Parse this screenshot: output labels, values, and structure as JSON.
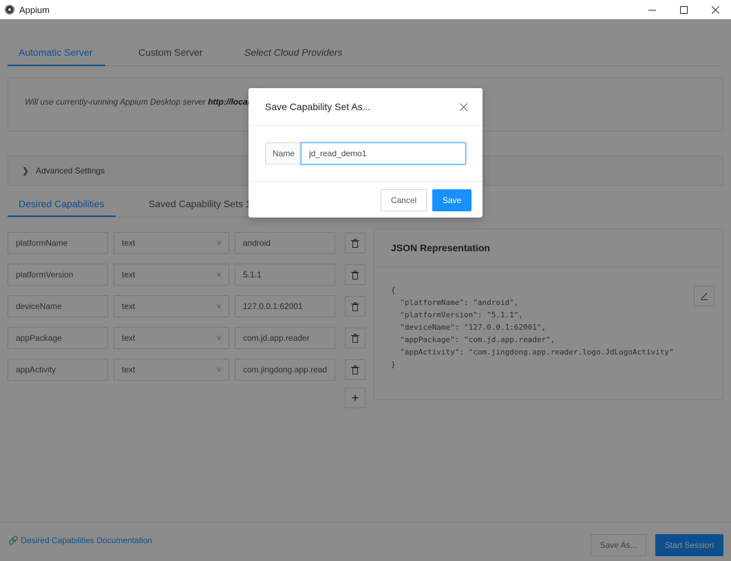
{
  "window": {
    "title": "Appium"
  },
  "server_tabs": [
    {
      "label": "Automatic Server"
    },
    {
      "label": "Custom Server"
    },
    {
      "label": "Select Cloud Providers"
    }
  ],
  "server_info": {
    "text": "Will use currently-running Appium Desktop server ",
    "url": "http://local"
  },
  "advanced": {
    "label": "Advanced Settings"
  },
  "caps_tabs": [
    {
      "label": "Desired Capabilities"
    },
    {
      "label": "Saved Capability Sets 1"
    }
  ],
  "capabilities": [
    {
      "name": "platformName",
      "type": "text",
      "value": "android"
    },
    {
      "name": "platformVersion",
      "type": "text",
      "value": "5.1.1"
    },
    {
      "name": "deviceName",
      "type": "text",
      "value": "127.0.0.1:62001"
    },
    {
      "name": "appPackage",
      "type": "text",
      "value": "com.jd.app.reader"
    },
    {
      "name": "appActivity",
      "type": "text",
      "value": "com.jingdong.app.read"
    }
  ],
  "json_panel": {
    "title": "JSON Representation",
    "content": "{\n  \"platformName\": \"android\",\n  \"platformVersion\": \"5.1.1\",\n  \"deviceName\": \"127.0.0.1:62001\",\n  \"appPackage\": \"com.jd.app.reader\",\n  \"appActivity\": \"com.jingdong.app.reader.logo.JdLogoActivity\"\n}"
  },
  "footer": {
    "doc_link": "Desired Capabilities Documentation",
    "save_as": "Save As...",
    "start_session": "Start Session"
  },
  "modal": {
    "title": "Save Capability Set As...",
    "field_label": "Name",
    "field_value": "jd_read_demo1",
    "cancel": "Cancel",
    "save": "Save"
  },
  "colors": {
    "accent": "#1890ff"
  }
}
